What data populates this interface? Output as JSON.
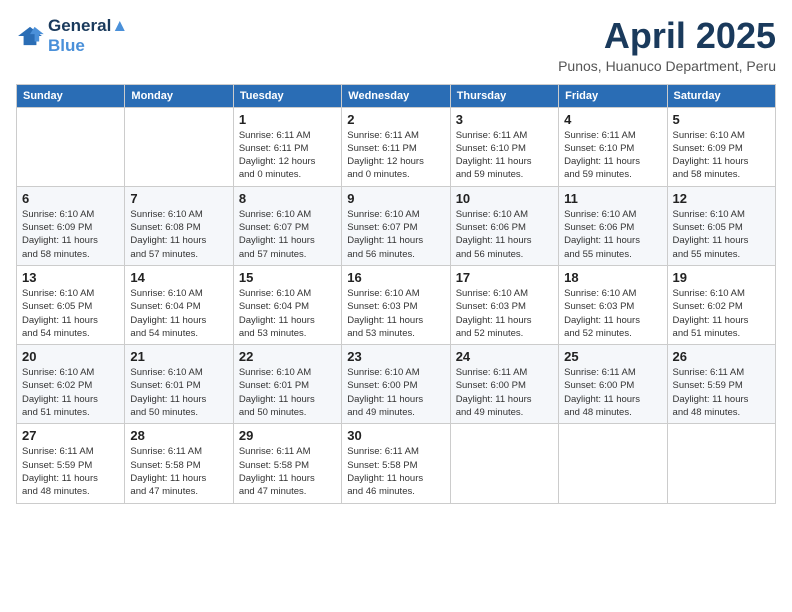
{
  "header": {
    "logo_line1": "General",
    "logo_line2": "Blue",
    "month": "April 2025",
    "location": "Punos, Huanuco Department, Peru"
  },
  "weekdays": [
    "Sunday",
    "Monday",
    "Tuesday",
    "Wednesday",
    "Thursday",
    "Friday",
    "Saturday"
  ],
  "weeks": [
    [
      {
        "day": "",
        "info": ""
      },
      {
        "day": "",
        "info": ""
      },
      {
        "day": "1",
        "info": "Sunrise: 6:11 AM\nSunset: 6:11 PM\nDaylight: 12 hours\nand 0 minutes."
      },
      {
        "day": "2",
        "info": "Sunrise: 6:11 AM\nSunset: 6:11 PM\nDaylight: 12 hours\nand 0 minutes."
      },
      {
        "day": "3",
        "info": "Sunrise: 6:11 AM\nSunset: 6:10 PM\nDaylight: 11 hours\nand 59 minutes."
      },
      {
        "day": "4",
        "info": "Sunrise: 6:11 AM\nSunset: 6:10 PM\nDaylight: 11 hours\nand 59 minutes."
      },
      {
        "day": "5",
        "info": "Sunrise: 6:10 AM\nSunset: 6:09 PM\nDaylight: 11 hours\nand 58 minutes."
      }
    ],
    [
      {
        "day": "6",
        "info": "Sunrise: 6:10 AM\nSunset: 6:09 PM\nDaylight: 11 hours\nand 58 minutes."
      },
      {
        "day": "7",
        "info": "Sunrise: 6:10 AM\nSunset: 6:08 PM\nDaylight: 11 hours\nand 57 minutes."
      },
      {
        "day": "8",
        "info": "Sunrise: 6:10 AM\nSunset: 6:07 PM\nDaylight: 11 hours\nand 57 minutes."
      },
      {
        "day": "9",
        "info": "Sunrise: 6:10 AM\nSunset: 6:07 PM\nDaylight: 11 hours\nand 56 minutes."
      },
      {
        "day": "10",
        "info": "Sunrise: 6:10 AM\nSunset: 6:06 PM\nDaylight: 11 hours\nand 56 minutes."
      },
      {
        "day": "11",
        "info": "Sunrise: 6:10 AM\nSunset: 6:06 PM\nDaylight: 11 hours\nand 55 minutes."
      },
      {
        "day": "12",
        "info": "Sunrise: 6:10 AM\nSunset: 6:05 PM\nDaylight: 11 hours\nand 55 minutes."
      }
    ],
    [
      {
        "day": "13",
        "info": "Sunrise: 6:10 AM\nSunset: 6:05 PM\nDaylight: 11 hours\nand 54 minutes."
      },
      {
        "day": "14",
        "info": "Sunrise: 6:10 AM\nSunset: 6:04 PM\nDaylight: 11 hours\nand 54 minutes."
      },
      {
        "day": "15",
        "info": "Sunrise: 6:10 AM\nSunset: 6:04 PM\nDaylight: 11 hours\nand 53 minutes."
      },
      {
        "day": "16",
        "info": "Sunrise: 6:10 AM\nSunset: 6:03 PM\nDaylight: 11 hours\nand 53 minutes."
      },
      {
        "day": "17",
        "info": "Sunrise: 6:10 AM\nSunset: 6:03 PM\nDaylight: 11 hours\nand 52 minutes."
      },
      {
        "day": "18",
        "info": "Sunrise: 6:10 AM\nSunset: 6:03 PM\nDaylight: 11 hours\nand 52 minutes."
      },
      {
        "day": "19",
        "info": "Sunrise: 6:10 AM\nSunset: 6:02 PM\nDaylight: 11 hours\nand 51 minutes."
      }
    ],
    [
      {
        "day": "20",
        "info": "Sunrise: 6:10 AM\nSunset: 6:02 PM\nDaylight: 11 hours\nand 51 minutes."
      },
      {
        "day": "21",
        "info": "Sunrise: 6:10 AM\nSunset: 6:01 PM\nDaylight: 11 hours\nand 50 minutes."
      },
      {
        "day": "22",
        "info": "Sunrise: 6:10 AM\nSunset: 6:01 PM\nDaylight: 11 hours\nand 50 minutes."
      },
      {
        "day": "23",
        "info": "Sunrise: 6:10 AM\nSunset: 6:00 PM\nDaylight: 11 hours\nand 49 minutes."
      },
      {
        "day": "24",
        "info": "Sunrise: 6:11 AM\nSunset: 6:00 PM\nDaylight: 11 hours\nand 49 minutes."
      },
      {
        "day": "25",
        "info": "Sunrise: 6:11 AM\nSunset: 6:00 PM\nDaylight: 11 hours\nand 48 minutes."
      },
      {
        "day": "26",
        "info": "Sunrise: 6:11 AM\nSunset: 5:59 PM\nDaylight: 11 hours\nand 48 minutes."
      }
    ],
    [
      {
        "day": "27",
        "info": "Sunrise: 6:11 AM\nSunset: 5:59 PM\nDaylight: 11 hours\nand 48 minutes."
      },
      {
        "day": "28",
        "info": "Sunrise: 6:11 AM\nSunset: 5:58 PM\nDaylight: 11 hours\nand 47 minutes."
      },
      {
        "day": "29",
        "info": "Sunrise: 6:11 AM\nSunset: 5:58 PM\nDaylight: 11 hours\nand 47 minutes."
      },
      {
        "day": "30",
        "info": "Sunrise: 6:11 AM\nSunset: 5:58 PM\nDaylight: 11 hours\nand 46 minutes."
      },
      {
        "day": "",
        "info": ""
      },
      {
        "day": "",
        "info": ""
      },
      {
        "day": "",
        "info": ""
      }
    ]
  ]
}
